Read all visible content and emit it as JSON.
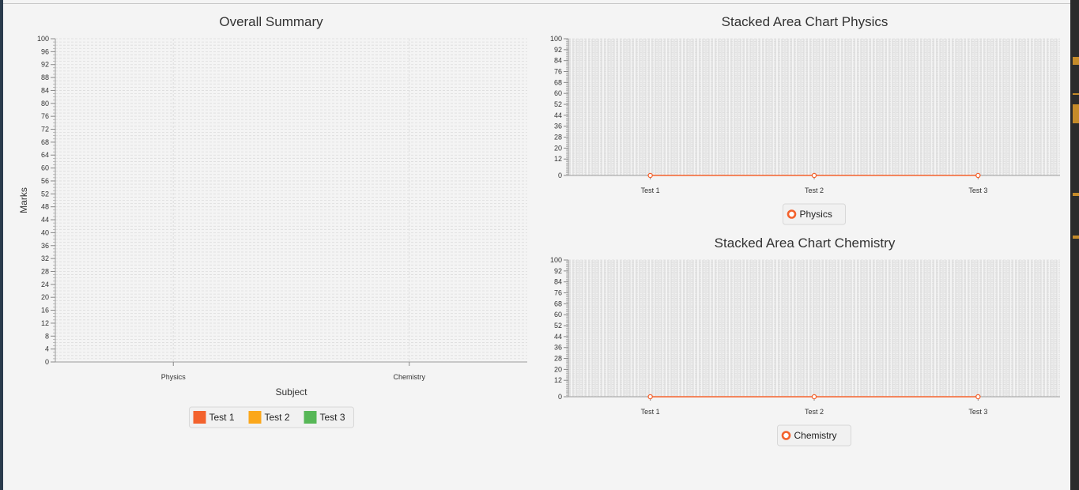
{
  "chart_data": [
    {
      "id": "overall",
      "type": "bar",
      "title": "Overall Summary",
      "xlabel": "Subject",
      "ylabel": "Marks",
      "categories": [
        "Physics",
        "Chemistry"
      ],
      "series": [
        {
          "name": "Test 1",
          "color": "#f3622d",
          "values": [
            0,
            0
          ]
        },
        {
          "name": "Test 2",
          "color": "#fba71b",
          "values": [
            0,
            0
          ]
        },
        {
          "name": "Test 3",
          "color": "#57b757",
          "values": [
            0,
            0
          ]
        }
      ],
      "ylim": [
        0,
        100
      ],
      "y_ticks": [
        0,
        4,
        8,
        12,
        16,
        20,
        24,
        28,
        32,
        36,
        40,
        44,
        48,
        52,
        56,
        60,
        64,
        68,
        72,
        76,
        80,
        84,
        88,
        92,
        96,
        100
      ],
      "grid": true,
      "legend": "bottom"
    },
    {
      "id": "physics",
      "type": "area",
      "title": "Stacked Area Chart Physics",
      "xlabel": "",
      "ylabel": "",
      "categories": [
        "Test 1",
        "Test 2",
        "Test 3"
      ],
      "series": [
        {
          "name": "Physics",
          "color": "#f3622d",
          "values": [
            0,
            0,
            0
          ]
        }
      ],
      "ylim": [
        0,
        100
      ],
      "y_ticks": [
        0,
        12,
        20,
        28,
        36,
        44,
        52,
        60,
        68,
        76,
        84,
        92,
        100
      ],
      "grid": true,
      "legend": "bottom"
    },
    {
      "id": "chemistry",
      "type": "area",
      "title": "Stacked Area Chart Chemistry",
      "xlabel": "",
      "ylabel": "",
      "categories": [
        "Test 1",
        "Test 2",
        "Test 3"
      ],
      "series": [
        {
          "name": "Chemistry",
          "color": "#f3622d",
          "values": [
            0,
            0,
            0
          ]
        }
      ],
      "ylim": [
        0,
        100
      ],
      "y_ticks": [
        0,
        12,
        20,
        28,
        36,
        44,
        52,
        60,
        68,
        76,
        84,
        92,
        100
      ],
      "grid": true,
      "legend": "bottom"
    }
  ]
}
